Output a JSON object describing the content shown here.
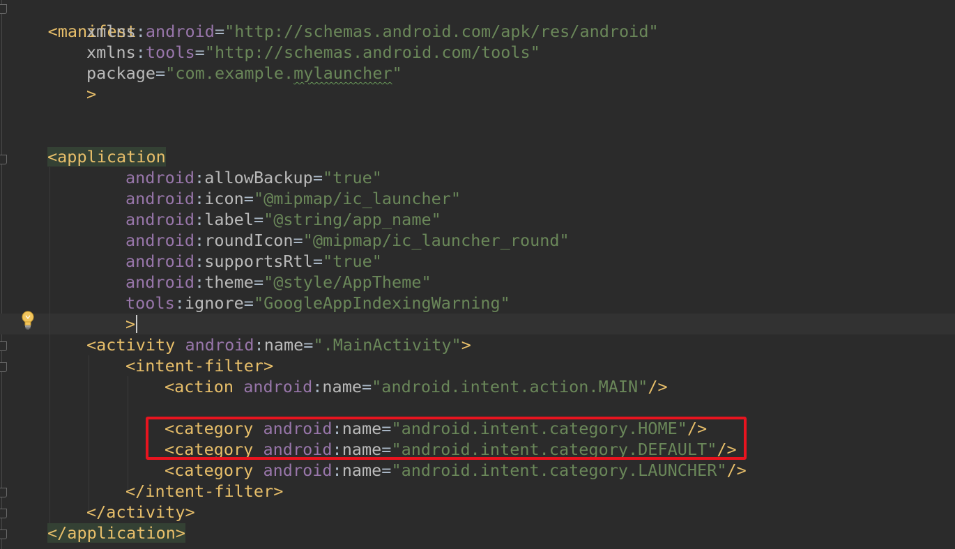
{
  "editor": {
    "language": "xml",
    "lines": [
      {
        "indent": 0,
        "tag": "<manifest"
      },
      {
        "indent": 1,
        "ns": "xmlns",
        "nsPrefix": "android",
        "value": "\"http://schemas.android.com/apk/res/android\""
      },
      {
        "indent": 1,
        "ns": "xmlns",
        "nsPrefix": "tools",
        "value": "\"http://schemas.android.com/tools\""
      },
      {
        "indent": 1,
        "attr": "package",
        "valuePrefix": "\"com.example.",
        "valueSquiggle": "mylauncher",
        "valueSuffix": "\""
      },
      {
        "indent": 1,
        "tag": ">"
      },
      {
        "indent": 0,
        "blank": true
      },
      {
        "indent": 0,
        "blank": true
      },
      {
        "indent": 1,
        "tag": "<application"
      },
      {
        "indent": 2,
        "ns": "android",
        "attr": "allowBackup",
        "value": "\"true\""
      },
      {
        "indent": 2,
        "ns": "android",
        "attr": "icon",
        "value": "\"@mipmap/ic_launcher\""
      },
      {
        "indent": 2,
        "ns": "android",
        "attr": "label",
        "value": "\"@string/app_name\""
      },
      {
        "indent": 2,
        "ns": "android",
        "attr": "roundIcon",
        "value": "\"@mipmap/ic_launcher_round\""
      },
      {
        "indent": 2,
        "ns": "android",
        "attr": "supportsRtl",
        "value": "\"true\""
      },
      {
        "indent": 2,
        "ns": "android",
        "attr": "theme",
        "value": "\"@style/AppTheme\""
      },
      {
        "indent": 2,
        "ns": "tools",
        "attr": "ignore",
        "value": "\"GoogleAppIndexingWarning\""
      },
      {
        "indent": 2,
        "tag": ">"
      }
    ],
    "line1": {
      "tag": "<manifest"
    },
    "line2": {
      "prefix": "xmlns",
      "ns": "android",
      "value": "\"http://schemas.android.com/apk/res/android\""
    },
    "line3": {
      "prefix": "xmlns",
      "ns": "tools",
      "value": "\"http://schemas.android.com/tools\""
    },
    "line4": {
      "attr": "package",
      "value_a": "\"com.example.",
      "value_b": "mylauncher",
      "value_c": "\""
    },
    "line5": {
      "tag": ">"
    },
    "line8": {
      "tag": "<application"
    },
    "line9": {
      "ns": "android",
      "attr": "allowBackup",
      "value": "\"true\""
    },
    "line10": {
      "ns": "android",
      "attr": "icon",
      "value": "\"@mipmap/ic_launcher\""
    },
    "line11": {
      "ns": "android",
      "attr": "label",
      "value": "\"@string/app_name\""
    },
    "line12": {
      "ns": "android",
      "attr": "roundIcon",
      "value": "\"@mipmap/ic_launcher_round\""
    },
    "line13": {
      "ns": "android",
      "attr": "supportsRtl",
      "value": "\"true\""
    },
    "line14": {
      "ns": "android",
      "attr": "theme",
      "value": "\"@style/AppTheme\""
    },
    "line15": {
      "ns": "tools",
      "attr": "ignore",
      "value": "\"GoogleAppIndexingWarning\""
    },
    "line16": {
      "tag": ">"
    },
    "line17": {
      "tag": "<activity",
      "ns": "android",
      "attr": "name",
      "value": "\".MainActivity\"",
      "close": ">"
    },
    "line18": {
      "tag": "<intent-filter>"
    },
    "line19": {
      "tag": "<action",
      "ns": "android",
      "attr": "name",
      "value": "\"android.intent.action.MAIN\"",
      "close": "/>"
    },
    "line21": {
      "tag": "<category",
      "ns": "android",
      "attr": "name",
      "value": "\"android.intent.category.HOME\"",
      "close": "/>"
    },
    "line22": {
      "tag": "<category",
      "ns": "android",
      "attr": "name",
      "value": "\"android.intent.category.DEFAULT\"",
      "close": "/>"
    },
    "line23": {
      "tag": "<category",
      "ns": "android",
      "attr": "name",
      "value": "\"android.intent.category.LAUNCHER\"",
      "close": "/>"
    },
    "line24": {
      "tag": "</intent-filter>"
    },
    "line25": {
      "tag": "</activity>"
    },
    "line26": {
      "tag": "</application>"
    },
    "colon": ":",
    "equals": "=",
    "space": " "
  },
  "annotation": {
    "color": "#e8141f"
  },
  "colors": {
    "background": "#2b2b2b",
    "tag": "#e8bf6a",
    "attribute": "#bababa",
    "namespace": "#9876aa",
    "string": "#6a8759"
  },
  "icons": {
    "intention": "lightbulb-icon"
  }
}
